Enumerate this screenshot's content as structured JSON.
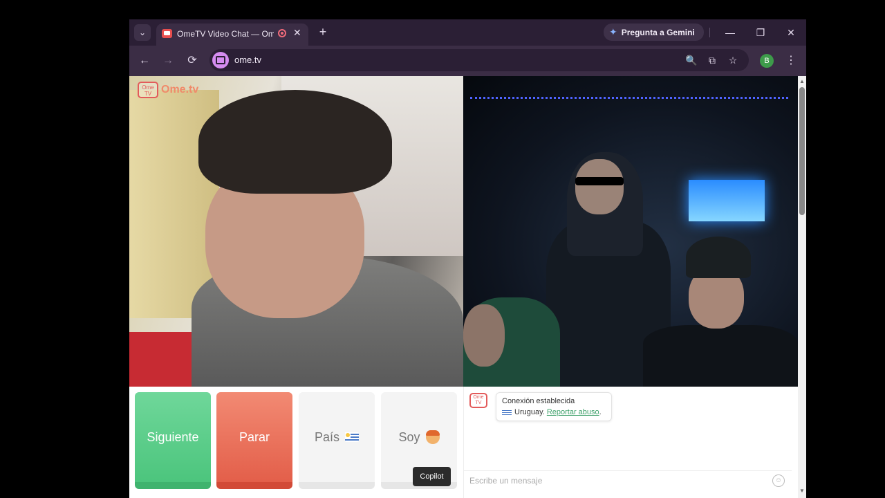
{
  "browser": {
    "tab_title": "OmeTV Video Chat — Ome",
    "tab_close": "✕",
    "new_tab": "+",
    "dropdown": "⌄",
    "gemini_label": "Pregunta a Gemini",
    "url": "ome.tv",
    "profile_initial": "B",
    "icons": {
      "back": "←",
      "forward": "→",
      "reload": "⟳",
      "zoom": "🔍",
      "install": "⧉",
      "bookmark": "☆",
      "menu": "⋮",
      "minimize": "—",
      "restore": "❐",
      "close": "✕"
    }
  },
  "logo": {
    "badge": "Ome TV",
    "text": "Ome.tv"
  },
  "controls": {
    "next": "Siguiente",
    "stop": "Parar",
    "country": "País",
    "sex": "Soy",
    "tooltip": "Copilot"
  },
  "chat": {
    "badge": "Ome TV",
    "status": "Conexión establecida",
    "country": "Uruguay.",
    "report": "Reportar abuso",
    "report_suffix": ".",
    "placeholder": "Escribe un mensaje"
  },
  "colors": {
    "next": "#4cc57d",
    "stop": "#e35f4a",
    "accent": "#3fa16b",
    "logo": "#e35b5b"
  }
}
